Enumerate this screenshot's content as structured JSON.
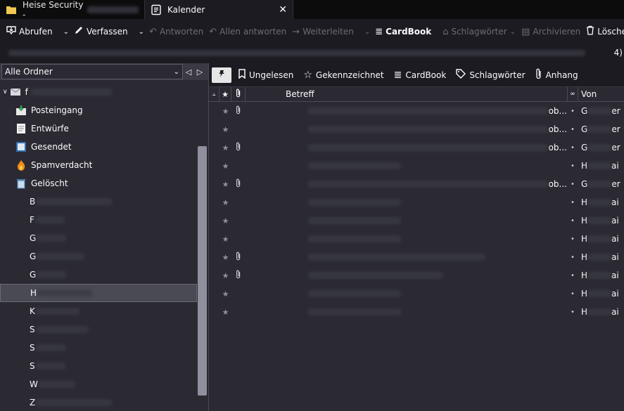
{
  "tabs": [
    {
      "title": "Heise Security -",
      "icon": "folder-icon"
    },
    {
      "title": "Kalender",
      "icon": "calendar-icon",
      "close": "✕"
    }
  ],
  "toolbar": {
    "get_messages": "Abrufen",
    "write": "Verfassen",
    "reply": "Antworten",
    "reply_all": "Allen antworten",
    "forward": "Weiterleiten",
    "cardbook": "CardBook",
    "tags": "Schlagwörter",
    "archive": "Archivieren",
    "delete": "Lösche"
  },
  "summary": {
    "tail": "4)"
  },
  "folder_pane": {
    "selector_label": "Alle Ordner",
    "account_initial": "f",
    "folders": [
      {
        "label": "Posteingang",
        "icon": "inbox-icon"
      },
      {
        "label": "Entwürfe",
        "icon": "drafts-icon"
      },
      {
        "label": "Gesendet",
        "icon": "sent-icon"
      },
      {
        "label": "Spamverdacht",
        "icon": "spam-icon"
      },
      {
        "label": "Gelöscht",
        "icon": "trash-icon"
      }
    ],
    "subfolders": [
      {
        "initial": "B",
        "selected": false
      },
      {
        "initial": "F",
        "selected": false
      },
      {
        "initial": "G",
        "selected": false
      },
      {
        "initial": "G",
        "selected": false
      },
      {
        "initial": "G",
        "selected": false
      },
      {
        "initial": "H",
        "selected": true
      },
      {
        "initial": "K",
        "selected": false
      },
      {
        "initial": "S",
        "selected": false
      },
      {
        "initial": "S",
        "selected": false
      },
      {
        "initial": "S",
        "selected": false
      },
      {
        "initial": "W",
        "selected": false
      },
      {
        "initial": "Z",
        "selected": false
      }
    ]
  },
  "quick_filter": {
    "unread": "Ungelesen",
    "starred": "Gekennzeichnet",
    "cardbook": "CardBook",
    "tags": "Schlagwörter",
    "attachment": "Anhang"
  },
  "columns": {
    "subject": "Betreff",
    "from": "Von"
  },
  "messages": [
    {
      "attachment": true,
      "subject_end": "ob...",
      "from_initial": "G",
      "from_end": "er"
    },
    {
      "attachment": false,
      "subject_end": "ob...",
      "from_initial": "G",
      "from_end": "er"
    },
    {
      "attachment": true,
      "subject_end": "ob...",
      "from_initial": "G",
      "from_end": "er"
    },
    {
      "attachment": false,
      "subject_end": "",
      "from_initial": "H",
      "from_end": "ai"
    },
    {
      "attachment": true,
      "subject_end": "ob...",
      "from_initial": "G",
      "from_end": "er"
    },
    {
      "attachment": false,
      "subject_end": "",
      "from_initial": "H",
      "from_end": "ai"
    },
    {
      "attachment": false,
      "subject_end": "",
      "from_initial": "H",
      "from_end": "ai"
    },
    {
      "attachment": false,
      "subject_end": "",
      "from_initial": "H",
      "from_end": "ai"
    },
    {
      "attachment": true,
      "subject_end": "",
      "from_initial": "H",
      "from_end": "ai"
    },
    {
      "attachment": true,
      "subject_end": "",
      "from_initial": "H",
      "from_end": "ai"
    },
    {
      "attachment": false,
      "subject_end": "",
      "from_initial": "H",
      "from_end": "ai"
    },
    {
      "attachment": false,
      "subject_end": "",
      "from_initial": "H",
      "from_end": "ai"
    }
  ]
}
